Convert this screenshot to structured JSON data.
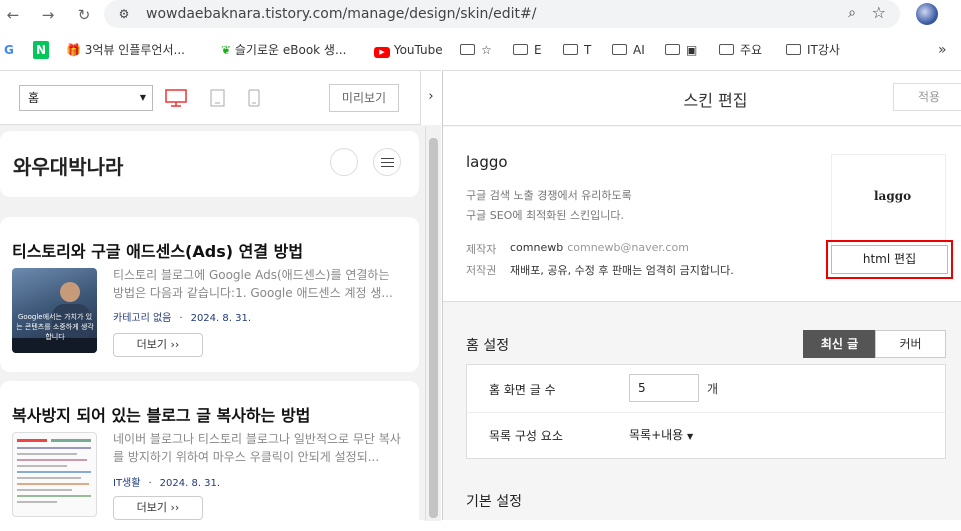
{
  "browser": {
    "url": "wowdaebaknara.tistory.com/manage/design/skin/edit#/",
    "bookmarks": [
      {
        "label": "3억뷰 인플루언서..."
      },
      {
        "label": "슬기로운 eBook 생..."
      },
      {
        "label": "YouTube"
      },
      {
        "label": "☆"
      },
      {
        "label": "E"
      },
      {
        "label": "T"
      },
      {
        "label": "AI"
      },
      {
        "label": "▣"
      },
      {
        "label": "주요"
      },
      {
        "label": "IT강사"
      }
    ]
  },
  "left": {
    "select_value": "홈",
    "preview_label": "미리보기",
    "blog_title": "와우대박나라",
    "posts": [
      {
        "title": "티스토리와 구글 애드센스(Ads) 연결 방법",
        "excerpt": "티스토리 블로그에 Google Ads(애드센스)를 연결하는 방법은 다음과 같습니다:1. Google 애드센스 계정 생...",
        "category": "카테고리 없음",
        "date": "2024. 8. 31.",
        "more": "더보기 ››",
        "thumb_text": "Google에서는 가치가 있는 콘텐츠를 소중하게 생각합니다"
      },
      {
        "title": "복사방지 되어 있는 블로그 글 복사하는 방법",
        "excerpt": "네이버 블로그나 티스토리 블로그나 일반적으로 무단 복사를 방지하기 위하여 마우스 우클릭이 안되게 설정되...",
        "category": "IT생활",
        "date": "2024. 8. 31.",
        "more": "더보기 ››"
      }
    ]
  },
  "right": {
    "title": "스킨 편집",
    "apply_label": "적용",
    "skin": {
      "name": "laggo",
      "desc1": "구글 검색 노출 경쟁에서 유리하도록",
      "desc2": "구글 SEO에 최적화된 스킨입니다.",
      "author_label": "제작자",
      "author": "comnewb",
      "email": "comnewb@naver.com",
      "copyright_label": "저작권",
      "copyright": "재배포, 공유, 수정 후 판매는 엄격히 금지합니다.",
      "logo_text": "laggo",
      "html_edit_label": "html 편집"
    },
    "home": {
      "section_title": "홈 설정",
      "tab_latest": "최신 글",
      "tab_cover": "커버",
      "count_label": "홈 화면 글 수",
      "count_value": "5",
      "count_unit": "개",
      "list_label": "목록 구성 요소",
      "list_value": "목록+내용"
    },
    "basic_title": "기본 설정"
  }
}
